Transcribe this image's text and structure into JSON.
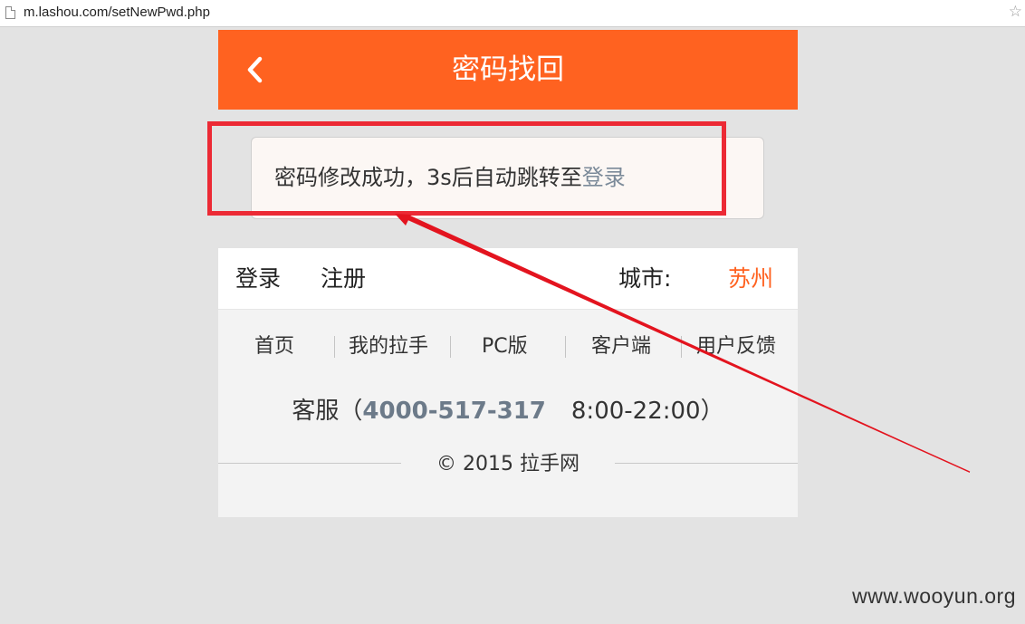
{
  "browser": {
    "url": "m.lashou.com/setNewPwd.php"
  },
  "header": {
    "title": "密码找回"
  },
  "message": {
    "text": "密码修改成功，3s后自动跳转至",
    "link_label": "登录"
  },
  "user_bar": {
    "login_label": "登录",
    "register_label": "注册",
    "city_label": "城市:",
    "city_name": "苏州"
  },
  "footer": {
    "nav": [
      {
        "label": "首页"
      },
      {
        "label": "我的拉手"
      },
      {
        "label": "PC版"
      },
      {
        "label": "客户端"
      },
      {
        "label": "用户反馈"
      }
    ],
    "service_prefix": "客服（",
    "service_phone": "4000-517-317",
    "service_hours": "8:00-22:00",
    "service_suffix": "）",
    "copyright": "© 2015 拉手网"
  },
  "watermark": "www.wooyun.org",
  "colors": {
    "header_bg": "#ff6220",
    "annotation_red": "#ec2a35",
    "link_gray": "#7b8a99",
    "page_bg": "#e3e3e3"
  },
  "icons": {
    "page": "page-icon",
    "star": "star-icon",
    "back": "chevron-left-icon"
  }
}
